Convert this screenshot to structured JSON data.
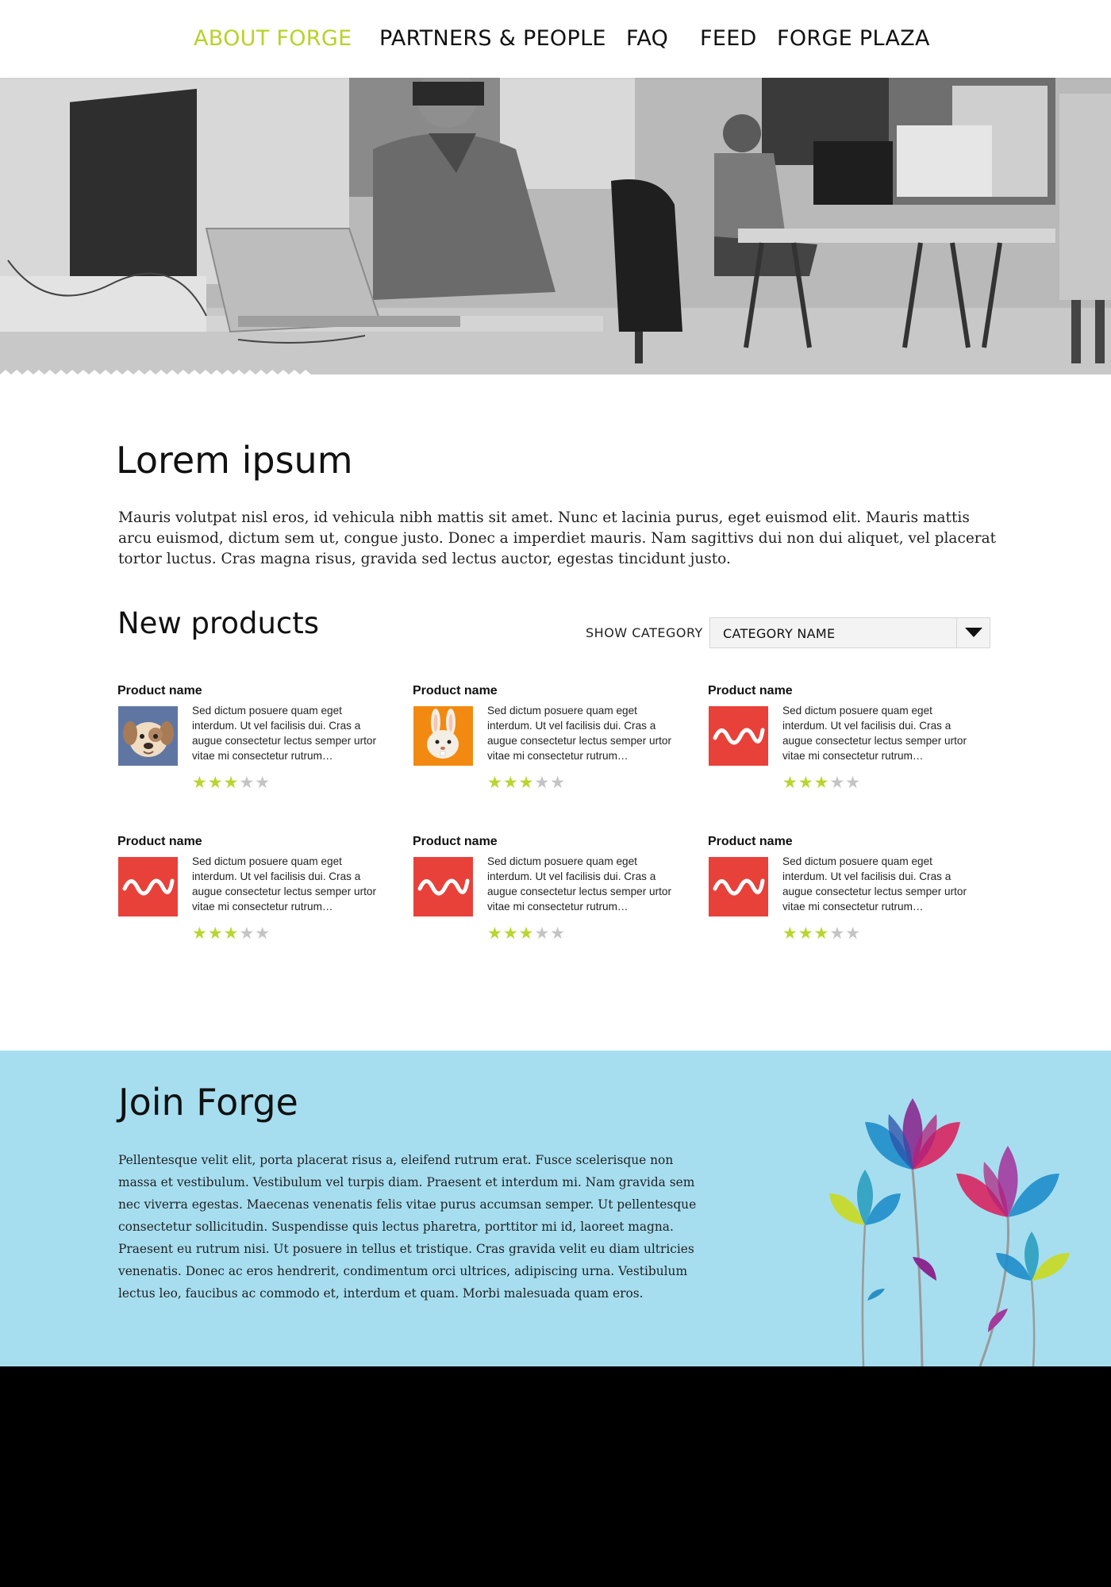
{
  "nav": {
    "items": [
      {
        "label": "ABOUT FORGE",
        "active": true
      },
      {
        "label": "PARTNERS & PEOPLE",
        "active": false
      },
      {
        "label": "FAQ",
        "active": false
      },
      {
        "label": "FEED",
        "active": false
      },
      {
        "label": "FORGE PLAZA",
        "active": false
      }
    ],
    "active_color": "#b5d32a"
  },
  "main": {
    "title": "Lorem ipsum",
    "intro": "Mauris volutpat nisl eros, id vehicula nibh mattis sit amet. Nunc et lacinia purus, eget euismod elit. Mauris mattis arcu euismod, dictum sem ut, congue justo. Donec a imperdiet mauris. Nam sagittivs dui non dui aliquet, vel placerat tortor luctus. Cras magna risus, gravida sed lectus auctor, egestas tincidunt justo."
  },
  "products_section": {
    "title": "New products",
    "filter_label": "SHOW CATEGORY",
    "selected_category": "CATEGORY NAME",
    "items": [
      {
        "name": "Product name",
        "icon": "dog-icon",
        "description": "Sed dictum posuere quam eget interdum. Ut vel facilisis dui. Cras a augue consectetur lectus semper urtor vitae mi consectetur rutrum…",
        "rating": 3,
        "max_rating": 5
      },
      {
        "name": "Product name",
        "icon": "rabbit-icon",
        "description": "Sed dictum posuere quam eget interdum. Ut vel facilisis dui. Cras a augue consectetur lectus semper urtor vitae mi consectetur rutrum…",
        "rating": 3,
        "max_rating": 5
      },
      {
        "name": "Product name",
        "icon": "wave-icon",
        "description": "Sed dictum posuere quam eget interdum. Ut vel facilisis dui. Cras a augue consectetur lectus semper urtor vitae mi consectetur rutrum…",
        "rating": 3,
        "max_rating": 5
      },
      {
        "name": "Product name",
        "icon": "wave-icon",
        "description": "Sed dictum posuere quam eget interdum. Ut vel facilisis dui. Cras a augue consectetur lectus semper urtor vitae mi consectetur rutrum…",
        "rating": 3,
        "max_rating": 5
      },
      {
        "name": "Product name",
        "icon": "wave-icon",
        "description": "Sed dictum posuere quam eget interdum. Ut vel facilisis dui. Cras a augue consectetur lectus semper urtor vitae mi consectetur rutrum…",
        "rating": 3,
        "max_rating": 5
      },
      {
        "name": "Product name",
        "icon": "wave-icon",
        "description": "Sed dictum posuere quam eget interdum. Ut vel facilisis dui. Cras a augue consectetur lectus semper urtor vitae mi consectetur rutrum…",
        "rating": 3,
        "max_rating": 5
      }
    ]
  },
  "join": {
    "title": "Join Forge",
    "text": "Pellentesque velit elit, porta placerat risus a, eleifend rutrum erat. Fusce scelerisque non massa et vestibulum. Vestibulum vel turpis diam. Praesent et interdum mi. Nam gravida sem nec viverra egestas. Maecenas venenatis felis vitae purus accumsan semper. Ut pellentesque consectetur sollicitudin. Suspendisse quis lectus pharetra, porttitor mi id, laoreet magna. Praesent eu rutrum nisi. Ut posuere in tellus et tristique. Cras gravida velit eu diam ultricies venenatis. Donec ac eros hendrerit, condimentum orci ultrices, adipiscing urna. Vestibulum lectus leo, faucibus ac commodo et, interdum et quam. Morbi malesuada quam eros.",
    "background": "#a6def0"
  },
  "colors": {
    "star_on": "#b8d630",
    "star_off": "#c4c4c4",
    "footer": "#000000"
  }
}
